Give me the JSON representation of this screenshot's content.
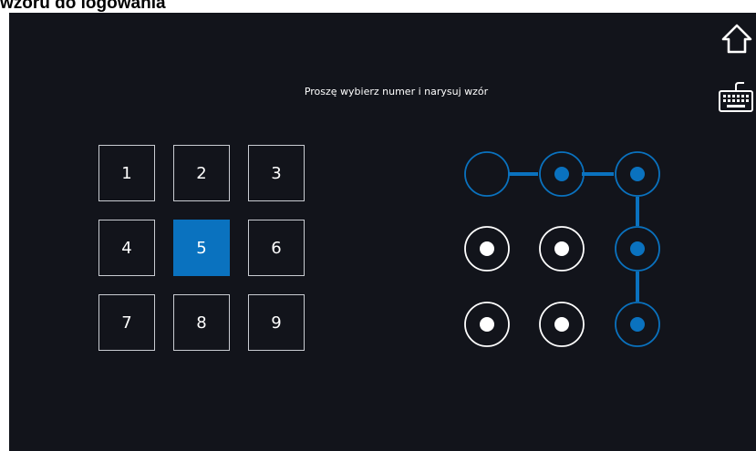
{
  "caption": "wzoru do logowania",
  "login_screen": {
    "instruction": "Proszę wybierz numer i narysuj wzór",
    "keypad": {
      "keys": [
        "1",
        "2",
        "3",
        "4",
        "5",
        "6",
        "7",
        "8",
        "9"
      ],
      "selected_key": "5"
    },
    "pattern": {
      "dots_state": [
        [
          "selected-empty",
          "selected",
          "selected"
        ],
        [
          "idle",
          "idle",
          "selected"
        ],
        [
          "idle",
          "idle",
          "selected"
        ]
      ],
      "connected_path": [
        [
          0,
          0
        ],
        [
          0,
          1
        ],
        [
          0,
          2
        ],
        [
          1,
          2
        ],
        [
          2,
          2
        ]
      ]
    },
    "icons": {
      "home": "home-icon",
      "keyboard": "keyboard-icon"
    },
    "colors": {
      "background": "#12141b",
      "accent": "#0a72bf",
      "idle": "#ffffff"
    }
  }
}
